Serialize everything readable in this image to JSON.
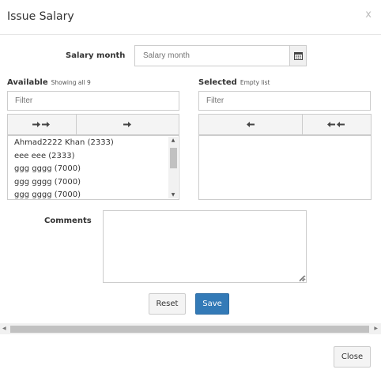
{
  "modal": {
    "title": "Issue Salary",
    "close_x": "x",
    "close_button": "Close"
  },
  "salary_month": {
    "label": "Salary month",
    "placeholder": "Salary month"
  },
  "available": {
    "label": "Available",
    "status": "Showing all 9",
    "filter_placeholder": "Filter",
    "move_all_glyph": "➔➔",
    "move_one_glyph": "➔",
    "items": [
      "Ahmad2222 Khan (2333)",
      "eee eee (2333)",
      "ggg gggg (7000)",
      "ggg gggg (7000)",
      "ggg gggg (7000)"
    ]
  },
  "selected": {
    "label": "Selected",
    "status": "Empty list",
    "filter_placeholder": "Filter",
    "remove_one_glyph": "🠐",
    "remove_all_glyph": "🠐🠐"
  },
  "comments": {
    "label": "Comments"
  },
  "actions": {
    "reset": "Reset",
    "save": "Save"
  },
  "icons": {
    "calendar": "calendar-icon",
    "scroll_up": "scroll-up-icon",
    "scroll_down": "scroll-down-icon"
  },
  "colors": {
    "primary": "#337ab7"
  }
}
